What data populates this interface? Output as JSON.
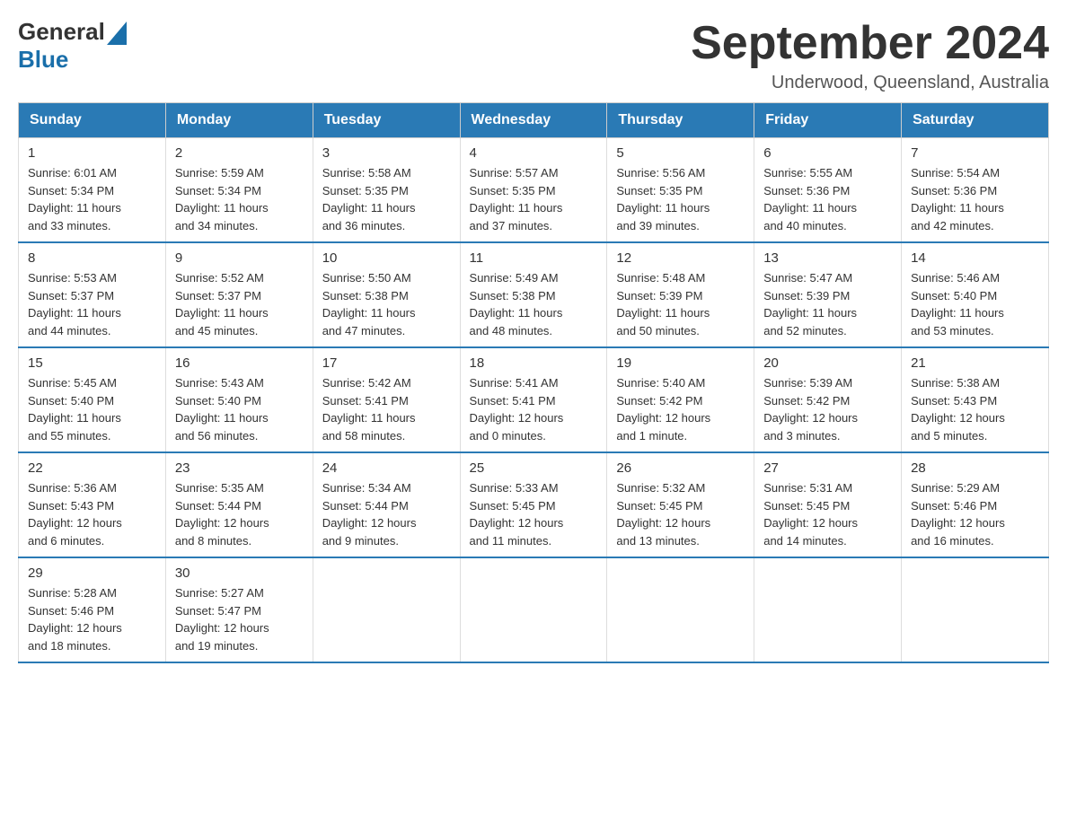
{
  "header": {
    "logo_general": "General",
    "logo_blue": "Blue",
    "title": "September 2024",
    "subtitle": "Underwood, Queensland, Australia"
  },
  "days_of_week": [
    "Sunday",
    "Monday",
    "Tuesday",
    "Wednesday",
    "Thursday",
    "Friday",
    "Saturday"
  ],
  "weeks": [
    [
      {
        "day": "1",
        "info": "Sunrise: 6:01 AM\nSunset: 5:34 PM\nDaylight: 11 hours\nand 33 minutes."
      },
      {
        "day": "2",
        "info": "Sunrise: 5:59 AM\nSunset: 5:34 PM\nDaylight: 11 hours\nand 34 minutes."
      },
      {
        "day": "3",
        "info": "Sunrise: 5:58 AM\nSunset: 5:35 PM\nDaylight: 11 hours\nand 36 minutes."
      },
      {
        "day": "4",
        "info": "Sunrise: 5:57 AM\nSunset: 5:35 PM\nDaylight: 11 hours\nand 37 minutes."
      },
      {
        "day": "5",
        "info": "Sunrise: 5:56 AM\nSunset: 5:35 PM\nDaylight: 11 hours\nand 39 minutes."
      },
      {
        "day": "6",
        "info": "Sunrise: 5:55 AM\nSunset: 5:36 PM\nDaylight: 11 hours\nand 40 minutes."
      },
      {
        "day": "7",
        "info": "Sunrise: 5:54 AM\nSunset: 5:36 PM\nDaylight: 11 hours\nand 42 minutes."
      }
    ],
    [
      {
        "day": "8",
        "info": "Sunrise: 5:53 AM\nSunset: 5:37 PM\nDaylight: 11 hours\nand 44 minutes."
      },
      {
        "day": "9",
        "info": "Sunrise: 5:52 AM\nSunset: 5:37 PM\nDaylight: 11 hours\nand 45 minutes."
      },
      {
        "day": "10",
        "info": "Sunrise: 5:50 AM\nSunset: 5:38 PM\nDaylight: 11 hours\nand 47 minutes."
      },
      {
        "day": "11",
        "info": "Sunrise: 5:49 AM\nSunset: 5:38 PM\nDaylight: 11 hours\nand 48 minutes."
      },
      {
        "day": "12",
        "info": "Sunrise: 5:48 AM\nSunset: 5:39 PM\nDaylight: 11 hours\nand 50 minutes."
      },
      {
        "day": "13",
        "info": "Sunrise: 5:47 AM\nSunset: 5:39 PM\nDaylight: 11 hours\nand 52 minutes."
      },
      {
        "day": "14",
        "info": "Sunrise: 5:46 AM\nSunset: 5:40 PM\nDaylight: 11 hours\nand 53 minutes."
      }
    ],
    [
      {
        "day": "15",
        "info": "Sunrise: 5:45 AM\nSunset: 5:40 PM\nDaylight: 11 hours\nand 55 minutes."
      },
      {
        "day": "16",
        "info": "Sunrise: 5:43 AM\nSunset: 5:40 PM\nDaylight: 11 hours\nand 56 minutes."
      },
      {
        "day": "17",
        "info": "Sunrise: 5:42 AM\nSunset: 5:41 PM\nDaylight: 11 hours\nand 58 minutes."
      },
      {
        "day": "18",
        "info": "Sunrise: 5:41 AM\nSunset: 5:41 PM\nDaylight: 12 hours\nand 0 minutes."
      },
      {
        "day": "19",
        "info": "Sunrise: 5:40 AM\nSunset: 5:42 PM\nDaylight: 12 hours\nand 1 minute."
      },
      {
        "day": "20",
        "info": "Sunrise: 5:39 AM\nSunset: 5:42 PM\nDaylight: 12 hours\nand 3 minutes."
      },
      {
        "day": "21",
        "info": "Sunrise: 5:38 AM\nSunset: 5:43 PM\nDaylight: 12 hours\nand 5 minutes."
      }
    ],
    [
      {
        "day": "22",
        "info": "Sunrise: 5:36 AM\nSunset: 5:43 PM\nDaylight: 12 hours\nand 6 minutes."
      },
      {
        "day": "23",
        "info": "Sunrise: 5:35 AM\nSunset: 5:44 PM\nDaylight: 12 hours\nand 8 minutes."
      },
      {
        "day": "24",
        "info": "Sunrise: 5:34 AM\nSunset: 5:44 PM\nDaylight: 12 hours\nand 9 minutes."
      },
      {
        "day": "25",
        "info": "Sunrise: 5:33 AM\nSunset: 5:45 PM\nDaylight: 12 hours\nand 11 minutes."
      },
      {
        "day": "26",
        "info": "Sunrise: 5:32 AM\nSunset: 5:45 PM\nDaylight: 12 hours\nand 13 minutes."
      },
      {
        "day": "27",
        "info": "Sunrise: 5:31 AM\nSunset: 5:45 PM\nDaylight: 12 hours\nand 14 minutes."
      },
      {
        "day": "28",
        "info": "Sunrise: 5:29 AM\nSunset: 5:46 PM\nDaylight: 12 hours\nand 16 minutes."
      }
    ],
    [
      {
        "day": "29",
        "info": "Sunrise: 5:28 AM\nSunset: 5:46 PM\nDaylight: 12 hours\nand 18 minutes."
      },
      {
        "day": "30",
        "info": "Sunrise: 5:27 AM\nSunset: 5:47 PM\nDaylight: 12 hours\nand 19 minutes."
      },
      null,
      null,
      null,
      null,
      null
    ]
  ]
}
